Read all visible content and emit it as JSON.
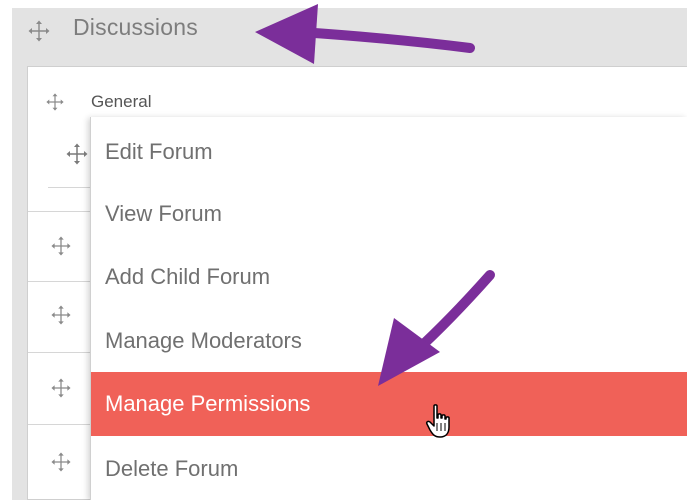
{
  "panel": {
    "title": "Discussions"
  },
  "category": {
    "label": "General"
  },
  "context_menu": {
    "items": [
      {
        "label": "Edit Forum"
      },
      {
        "label": "View Forum"
      },
      {
        "label": "Add Child Forum"
      },
      {
        "label": "Manage Moderators"
      },
      {
        "label": "Manage Permissions",
        "highlighted": true
      },
      {
        "label": "Delete Forum"
      }
    ]
  },
  "icons": {
    "move": "move-icon",
    "cursor": "hand-pointer-icon",
    "annotation": "arrow-icon"
  },
  "colors": {
    "highlight": "#f06158",
    "arrow": "#7b2e9a",
    "panel_bg": "#e3e3e3",
    "menu_text": "#707070"
  }
}
